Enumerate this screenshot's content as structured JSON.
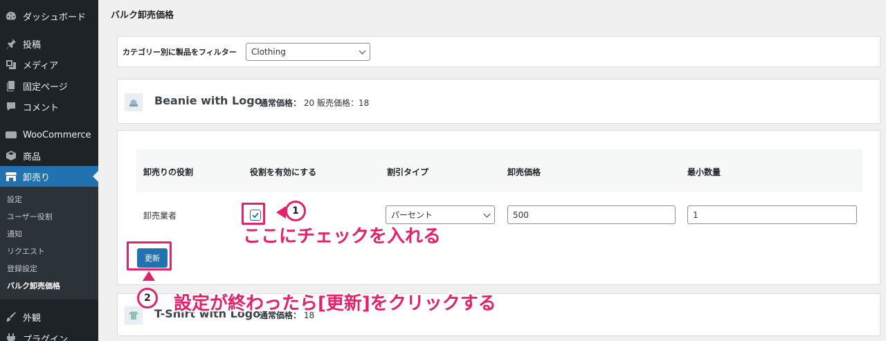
{
  "sidebar": {
    "items": [
      {
        "label": "ダッシュボード",
        "icon": "dashboard-icon"
      },
      {
        "label": "投稿",
        "icon": "pin-icon"
      },
      {
        "label": "メディア",
        "icon": "media-icon"
      },
      {
        "label": "固定ページ",
        "icon": "page-icon"
      },
      {
        "label": "コメント",
        "icon": "comment-icon"
      },
      {
        "label": "WooCommerce",
        "icon": "woo-icon"
      },
      {
        "label": "商品",
        "icon": "product-icon"
      },
      {
        "label": "卸売り",
        "icon": "store-icon"
      },
      {
        "label": "外観",
        "icon": "brush-icon"
      },
      {
        "label": "プラグイン",
        "icon": "plugin-icon"
      }
    ],
    "submenu": [
      "設定",
      "ユーザー役割",
      "通知",
      "リクエスト",
      "登録設定",
      "バルク卸売価格"
    ]
  },
  "page_title": "バルク卸売価格",
  "filter": {
    "label": "カテゴリー別に製品をフィルター",
    "selected": "Clothing"
  },
  "product1": {
    "name": "Beanie with Logo",
    "regular_label": "通常価格：",
    "regular_value": "20",
    "sale_label": "販売価格：",
    "sale_value": "18"
  },
  "table": {
    "headers": [
      "卸売りの役割",
      "役割を有効にする",
      "割引タイプ",
      "卸売価格",
      "最小数量"
    ],
    "row": {
      "role": "卸売業者",
      "enabled": true,
      "discount_type": "パーセント",
      "price": "500",
      "min_qty": "1"
    }
  },
  "update_label": "更新",
  "product2": {
    "name": "T-Shirt with Logo",
    "regular_label": "通常価格：",
    "regular_value": "18"
  },
  "annotations": {
    "step1_num": "1",
    "step1_text": "ここにチェックを入れる",
    "step2_num": "2",
    "step2_text": "設定が終わったら[更新]をクリックする",
    "accent": "#e6216b"
  }
}
